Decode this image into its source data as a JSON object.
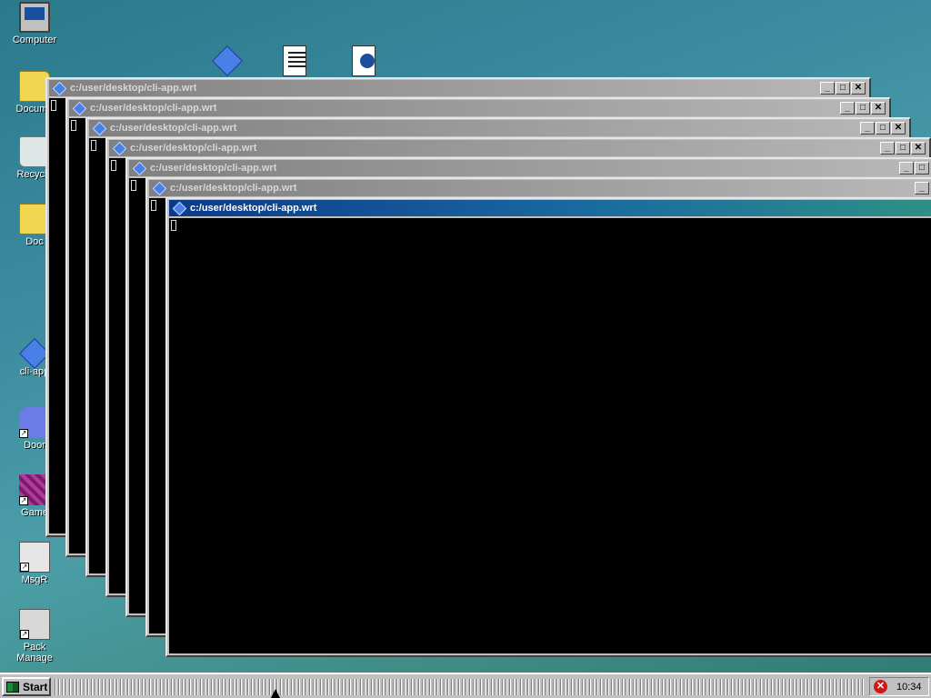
{
  "desktop": {
    "icons": [
      {
        "label": "Computer",
        "icon": "computer-icon"
      },
      {
        "label": "Docume",
        "icon": "documents-folder-icon"
      },
      {
        "label": "Recycle",
        "icon": "recycle-bin-icon"
      },
      {
        "label": "Doc",
        "icon": "folder-icon"
      },
      {
        "label": "cli-app",
        "icon": "diamond-app-icon"
      },
      {
        "label": "Door",
        "icon": "discord-icon"
      },
      {
        "label": "Game",
        "icon": "game-icon"
      },
      {
        "label": "MsgR",
        "icon": "message-reader-icon"
      },
      {
        "label": "Pack Manage",
        "icon": "package-manager-icon"
      }
    ],
    "top_icons": [
      {
        "icon": "diamond-app-icon"
      },
      {
        "icon": "text-document-icon"
      },
      {
        "icon": "web-document-icon"
      }
    ]
  },
  "windows": [
    {
      "title": "c:/user/desktop/cli-app.wrt",
      "active": false
    },
    {
      "title": "c:/user/desktop/cli-app.wrt",
      "active": false
    },
    {
      "title": "c:/user/desktop/cli-app.wrt",
      "active": false
    },
    {
      "title": "c:/user/desktop/cli-app.wrt",
      "active": false
    },
    {
      "title": "c:/user/desktop/cli-app.wrt",
      "active": false
    },
    {
      "title": "c:/user/desktop/cli-app.wrt",
      "active": false
    },
    {
      "title": "c:/user/desktop/cli-app.wrt",
      "active": true
    }
  ],
  "window_buttons": {
    "minimize": "_",
    "maximize": "□",
    "close": "✕"
  },
  "taskbar": {
    "start_label": "Start",
    "clock": "10:34",
    "tray_icon": "error-icon",
    "tray_symbol": "✕"
  }
}
